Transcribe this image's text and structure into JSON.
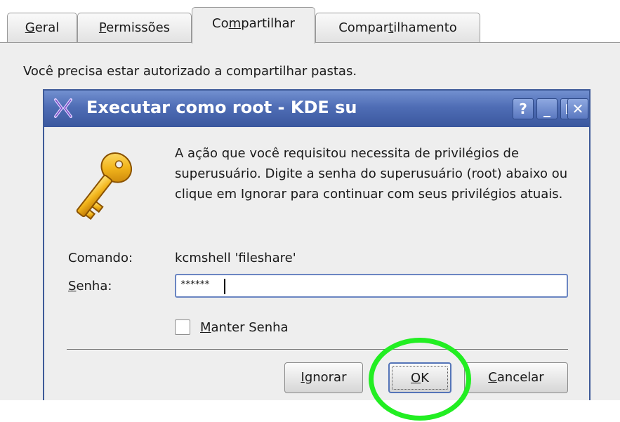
{
  "tabs": [
    {
      "label": "Geral",
      "mnemonic": "G",
      "rest": "eral",
      "pre": ""
    },
    {
      "label": "Permissões",
      "mnemonic": "P",
      "rest": "ermissões",
      "pre": ""
    },
    {
      "label": "Compartilhar",
      "pre": "Co",
      "mnemonic": "m",
      "rest": "partilhar"
    },
    {
      "label": "Compartilhamento",
      "pre": "Compar",
      "mnemonic": "t",
      "rest": "ilhamento"
    }
  ],
  "active_tab": "Compartilhar",
  "auth_message": "Você precisa estar autorizado a compartilhar pastas.",
  "dialog": {
    "title": "Executar como root - KDE su",
    "title_buttons": {
      "help": "?",
      "minimize": "_",
      "maximize": "□",
      "close": "✕"
    },
    "message": "A ação que você requisitou necessita de privilégios de superusuário. Digite a senha do superusuário (root) abaixo ou clique em Ignorar para continuar com seus privilégios atuais.",
    "command_label": "Comando:",
    "command_value": "kcmshell 'fileshare'",
    "password_label_mnemonic": "S",
    "password_label_rest": "enha:",
    "password_mask": "******",
    "keep_password_mnemonic": "M",
    "keep_password_rest": "anter Senha",
    "keep_password_checked": false,
    "buttons": {
      "ignore_mnemonic": "I",
      "ignore_rest": "gnorar",
      "ok_mnemonic": "O",
      "ok_rest": "K",
      "cancel_mnemonic": "C",
      "cancel_rest": "ancelar"
    }
  },
  "colors": {
    "titlebar": "#4f6db5",
    "highlight_ring": "#22ee22",
    "panel_bg": "#eeeeee"
  },
  "icons": [
    "kde-logo-icon",
    "key-icon",
    "help-icon",
    "minimize-icon",
    "maximize-icon",
    "close-icon"
  ]
}
